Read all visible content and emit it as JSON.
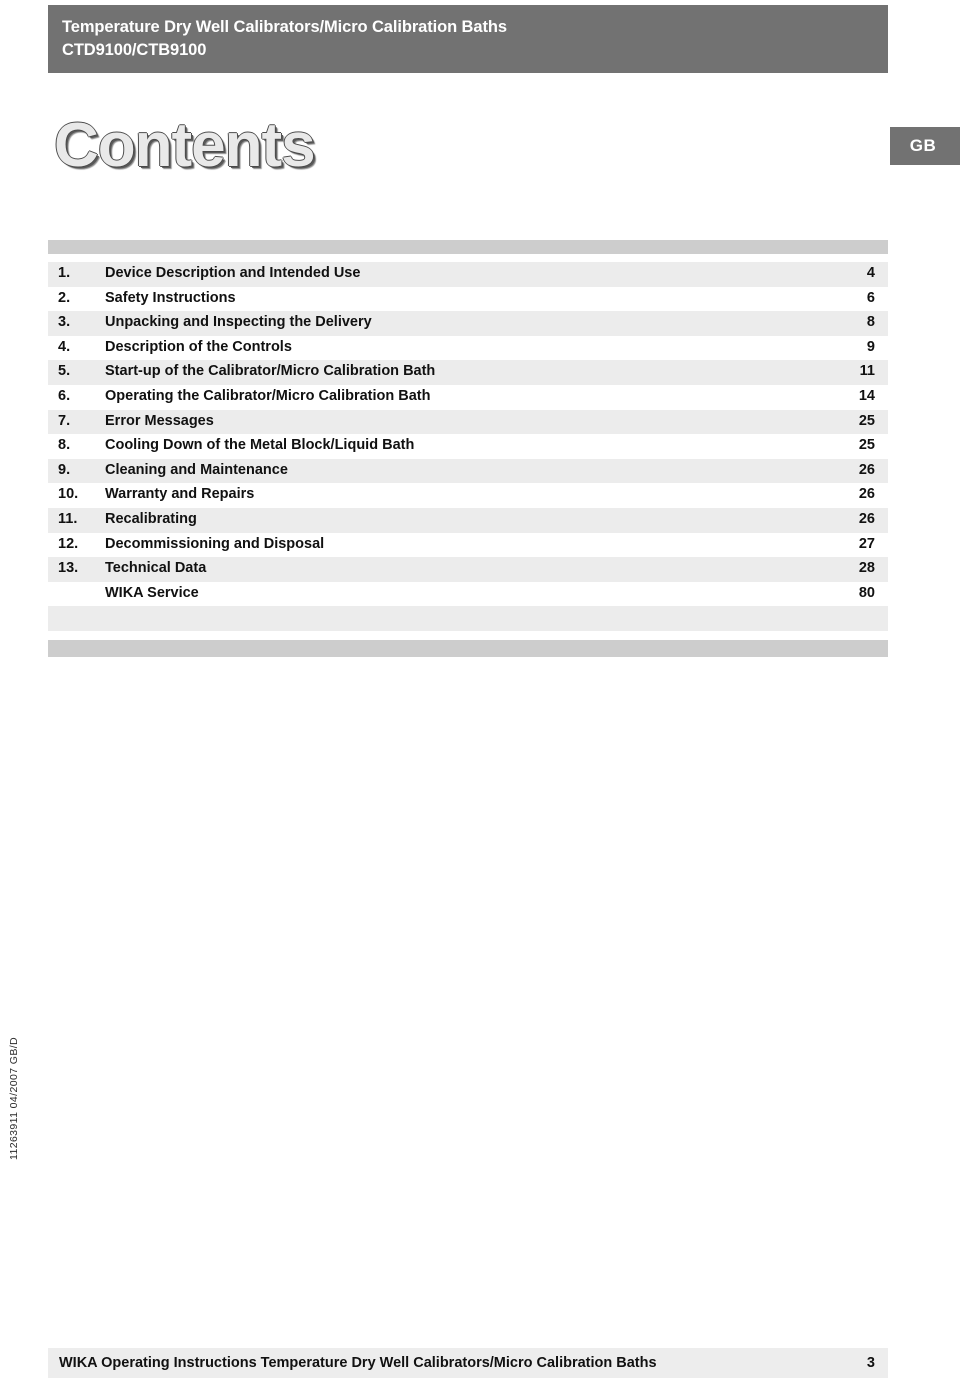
{
  "header": {
    "title_line1": "Temperature Dry Well Calibrators/Micro Calibration Baths",
    "title_line2": "CTD9100/CTB9100",
    "bar_color": "#727272",
    "text_color": "#ffffff"
  },
  "page_title": "Contents",
  "language_badge": {
    "label": "GB",
    "bar_color": "#727272"
  },
  "toc": {
    "stripe_color": "#ececec",
    "bar_color": "#cdcdcd",
    "entries": [
      {
        "number": "1.",
        "label": "Device Description and Intended Use",
        "page": "4"
      },
      {
        "number": "2.",
        "label": "Safety Instructions",
        "page": "6"
      },
      {
        "number": "3.",
        "label": "Unpacking and Inspecting the Delivery",
        "page": "8"
      },
      {
        "number": "4.",
        "label": "Description of the Controls",
        "page": "9"
      },
      {
        "number": "5.",
        "label": "Start-up of the Calibrator/Micro Calibration Bath",
        "page": "11"
      },
      {
        "number": "6.",
        "label": "Operating the Calibrator/Micro Calibration Bath",
        "page": "14"
      },
      {
        "number": "7.",
        "label": "Error Messages",
        "page": "25"
      },
      {
        "number": "8.",
        "label": "Cooling Down of the Metal Block/Liquid Bath",
        "page": "25"
      },
      {
        "number": "9.",
        "label": "Cleaning and Maintenance",
        "page": "26"
      },
      {
        "number": "10.",
        "label": "Warranty and Repairs",
        "page": "26"
      },
      {
        "number": "11.",
        "label": "Recalibrating",
        "page": "26"
      },
      {
        "number": "12.",
        "label": "Decommissioning and Disposal",
        "page": "27"
      },
      {
        "number": "13.",
        "label": "Technical Data",
        "page": "28"
      },
      {
        "number": "",
        "label": "WIKA Service",
        "page": "80"
      }
    ]
  },
  "side_code": "11263911  04/2007 GB/D",
  "footer": {
    "text": "WIKA Operating Instructions Temperature Dry Well Calibrators/Micro Calibration Baths",
    "page_number": "3",
    "bar_color": "#ededed"
  }
}
